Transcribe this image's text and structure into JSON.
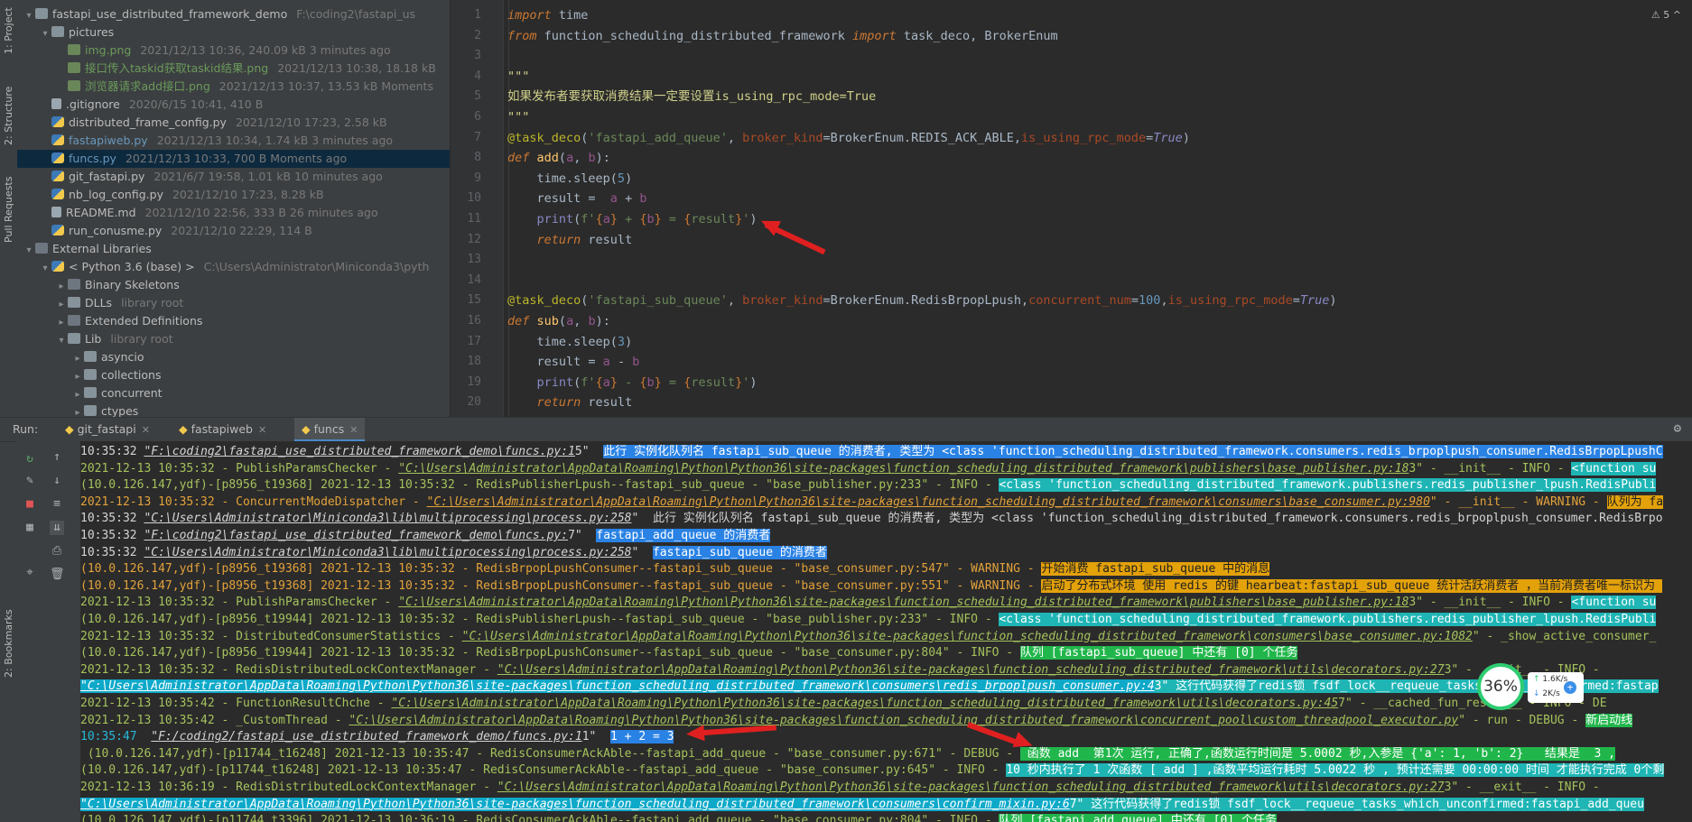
{
  "toolstrip": {
    "tabs": [
      "1: Project",
      "2: Structure",
      "Pull Requests",
      "2: Bookmarks"
    ]
  },
  "project": {
    "rows": [
      {
        "indent": 0,
        "arrow": "▾",
        "icon": "folder",
        "name": "fastapi_use_distributed_framework_demo",
        "meta": "F:\\coding2\\fastapi_us",
        "cls": ""
      },
      {
        "indent": 1,
        "arrow": "▾",
        "icon": "folder",
        "name": "pictures",
        "meta": "",
        "cls": ""
      },
      {
        "indent": 2,
        "arrow": "",
        "icon": "png",
        "name": "img.png",
        "meta": "2021/12/13 10:36, 240.09 kB 3 minutes ago",
        "cls": "name-green"
      },
      {
        "indent": 2,
        "arrow": "",
        "icon": "png",
        "name": "接口传入taskid获取taskid结果.png",
        "meta": "2021/12/13 10:38, 18.18 kB",
        "cls": "name-green"
      },
      {
        "indent": 2,
        "arrow": "",
        "icon": "png",
        "name": "浏览器请求add接口.png",
        "meta": "2021/12/13 10:37, 13.53 kB Moments",
        "cls": "name-green"
      },
      {
        "indent": 1,
        "arrow": "",
        "icon": "file",
        "name": ".gitignore",
        "meta": "2020/6/15 10:41, 410 B",
        "cls": ""
      },
      {
        "indent": 1,
        "arrow": "",
        "icon": "py",
        "name": "distributed_frame_config.py",
        "meta": "2021/12/10 17:23, 2.58 kB",
        "cls": ""
      },
      {
        "indent": 1,
        "arrow": "",
        "icon": "py",
        "name": "fastapiweb.py",
        "meta": "2021/12/13 10:34, 1.74 kB 3 minutes ago",
        "cls": "name-blue"
      },
      {
        "indent": 1,
        "arrow": "",
        "icon": "py",
        "name": "funcs.py",
        "meta": "2021/12/13 10:33, 700 B Moments ago",
        "cls": "name-blue",
        "selected": true
      },
      {
        "indent": 1,
        "arrow": "",
        "icon": "py",
        "name": "git_fastapi.py",
        "meta": "2021/6/7 19:58, 1.01 kB 10 minutes ago",
        "cls": ""
      },
      {
        "indent": 1,
        "arrow": "",
        "icon": "py",
        "name": "nb_log_config.py",
        "meta": "2021/12/10 17:23, 8.28 kB",
        "cls": ""
      },
      {
        "indent": 1,
        "arrow": "",
        "icon": "file",
        "name": "README.md",
        "meta": "2021/12/10 22:56, 333 B 26 minutes ago",
        "cls": ""
      },
      {
        "indent": 1,
        "arrow": "",
        "icon": "py",
        "name": "run_conusme.py",
        "meta": "2021/12/10 22:29, 114 B",
        "cls": ""
      },
      {
        "indent": 0,
        "arrow": "▾",
        "icon": "lib",
        "name": "External Libraries",
        "meta": "",
        "cls": ""
      },
      {
        "indent": 1,
        "arrow": "▾",
        "icon": "py",
        "name": "< Python 3.6 (base) >",
        "meta": "C:\\Users\\Administrator\\Miniconda3\\pyth",
        "cls": ""
      },
      {
        "indent": 2,
        "arrow": "▸",
        "icon": "lib",
        "name": "Binary Skeletons",
        "meta": "",
        "cls": ""
      },
      {
        "indent": 2,
        "arrow": "▸",
        "icon": "folder",
        "name": "DLLs",
        "meta": "library root",
        "cls": ""
      },
      {
        "indent": 2,
        "arrow": "▸",
        "icon": "lib",
        "name": "Extended Definitions",
        "meta": "",
        "cls": ""
      },
      {
        "indent": 2,
        "arrow": "▾",
        "icon": "folder",
        "name": "Lib",
        "meta": "library root",
        "cls": ""
      },
      {
        "indent": 3,
        "arrow": "▸",
        "icon": "folder",
        "name": "asyncio",
        "meta": "",
        "cls": ""
      },
      {
        "indent": 3,
        "arrow": "▸",
        "icon": "folder",
        "name": "collections",
        "meta": "",
        "cls": ""
      },
      {
        "indent": 3,
        "arrow": "▸",
        "icon": "folder",
        "name": "concurrent",
        "meta": "",
        "cls": ""
      },
      {
        "indent": 3,
        "arrow": "▸",
        "icon": "folder",
        "name": "ctypes",
        "meta": "",
        "cls": ""
      }
    ]
  },
  "editor": {
    "warning_badge": "⚠ 5  ^",
    "lines": [
      {
        "n": "1",
        "html": "<span class='kw'>import</span> time"
      },
      {
        "n": "2",
        "html": "<span class='kw'>from</span> function_scheduling_distributed_framework <span class='kw'>import</span> task_deco, BrokerEnum"
      },
      {
        "n": "3",
        "html": ""
      },
      {
        "n": "4",
        "html": "<span class='doc'>\"\"\"</span>"
      },
      {
        "n": "5",
        "html": "<span class='doc'>如果发布者要获取消费结果一定要设置is_using_rpc_mode=True</span>"
      },
      {
        "n": "6",
        "html": "<span class='doc'>\"\"\"</span>"
      },
      {
        "n": "7",
        "html": "<span class='ann'>@task_deco</span>(<span class='str'>'fastapi_add_queue'</span>, <span class='kwarg'>broker_kind</span>=BrokerEnum.REDIS_ACK_ABLE,<span class='kwarg'>is_using_rpc_mode</span>=<span class='trueval'>True</span>)"
      },
      {
        "n": "8",
        "html": "<span class='kw'>def</span> <span class='fn'>add</span>(<span class='prm'>a</span>, <span class='prm'>b</span>):"
      },
      {
        "n": "9",
        "html": "    time.sleep(<span class='num'>5</span>)"
      },
      {
        "n": "10",
        "html": "    result =  <span class='prm'>a</span> + <span class='prm'>b</span>"
      },
      {
        "n": "11",
        "html": "    <span class='fn' style='color:#8888c6'>print</span>(<span class='fstr'>f'<span class='brace'>{</span><span class='prm'>a</span><span class='brace'>}</span> + <span class='brace'>{</span><span class='prm'>b</span><span class='brace'>}</span> = <span class='brace'>{</span>result<span class='brace'>}</span>'</span>)"
      },
      {
        "n": "12",
        "html": "    <span class='kw'>return</span> result"
      },
      {
        "n": "13",
        "html": ""
      },
      {
        "n": "14",
        "html": ""
      },
      {
        "n": "15",
        "html": "<span class='ann'>@task_deco</span>(<span class='str'>'fastapi_sub_queue'</span>, <span class='kwarg'>broker_kind</span>=BrokerEnum.RedisBrpopLpush,<span class='kwarg'>concurrent_num</span>=<span class='num'>100</span>,<span class='kwarg'>is_using_rpc_mode</span>=<span class='trueval'>True</span>)"
      },
      {
        "n": "16",
        "html": "<span class='kw'>def</span> <span class='fn'>sub</span>(<span class='prm'>a</span>, <span class='prm'>b</span>):"
      },
      {
        "n": "17",
        "html": "    time.sleep(<span class='num'>3</span>)"
      },
      {
        "n": "18",
        "html": "    result = <span class='prm'>a</span> - <span class='prm'>b</span>"
      },
      {
        "n": "19",
        "html": "    <span class='fn' style='color:#8888c6'>print</span>(<span class='fstr'>f'<span class='brace'>{</span><span class='prm'>a</span><span class='brace'>}</span> - <span class='brace'>{</span><span class='prm'>b</span><span class='brace'>}</span> = <span class='brace'>{</span>result<span class='brace'>}</span>'</span>)"
      },
      {
        "n": "20",
        "html": "    <span class='kw'>return</span> result"
      }
    ]
  },
  "run": {
    "label": "Run:",
    "tabs": [
      {
        "name": "git_fastapi",
        "active": false
      },
      {
        "name": "fastapiweb",
        "active": false
      },
      {
        "name": "funcs",
        "active": true
      }
    ],
    "tool_icons": [
      "rerun-icon",
      "up-icon",
      "wrench-icon",
      "down-icon",
      "stop-icon",
      "soft-wrap-icon",
      "layout-icon",
      "scroll-end-icon",
      "print-icon",
      "pin-icon",
      "trash-icon"
    ]
  },
  "console": {
    "lines": [
      "<span class='c-white'>10:35:32 </span><span class='c-link'>\"F:\\coding2\\fastapi_use_distributed_framework_demo\\funcs.py:1</span><span class='c-white'>5\"  </span><span class='hl-blue'>此行 实例化队列名 fastapi_sub_queue 的消费者, 类型为 &lt;class 'function_scheduling_distributed_framework.consumers.redis_brpoplpush_consumer.RedisBrpopLpushC</span>",
      "<span class='c-green'>2021-12-13 10:35:32 - PublishParamsChecker - </span><span class='c-link' style='color:#a5c25c'>\"C:\\Users\\Administrator\\AppData\\Roaming\\Python\\Python36\\site-packages\\function_scheduling_distributed_framework\\publishers\\base_publisher.py:18</span><span class='c-green'>3\" - __init__ - INFO - </span><span class='hl-teal'>&lt;function su</span>",
      "<span class='c-green'>(10.0.126.147,ydf)-[p8956_t19368] 2021-12-13 10:35:32 - RedisPublisherLpush--fastapi_sub_queue - \"base_publisher.py:233\" - INFO - </span><span class='hl-teal'>&lt;class 'function_scheduling_distributed_framework.publishers.redis_publisher_lpush.RedisPubli</span>",
      "<span class='c-orange'>2021-12-13 10:35:32 - ConcurrentModeDispatcher - </span><span class='c-link' style='color:#e3a23b'>\"C:\\Users\\Administrator\\AppData\\Roaming\\Python\\Python36\\site-packages\\function_scheduling_distributed_framework\\consumers\\base_consumer.py:980</span><span class='c-orange'>\" - __init__ - WARNING - </span><span class='hl-orange'>队列为 fa</span>",
      "<span class='c-white'>10:35:32 </span><span class='c-link'>\"C:\\Users\\Administrator\\Miniconda3\\lib\\multiprocessing\\process.py:258</span><span class='c-white'>\"  此行 实例化队列名 fastapi_sub_queue 的消费者, 类型为 &lt;class 'function_scheduling_distributed_framework.consumers.redis_brpoplpush_consumer.RedisBrpo</span>",
      "<span class='c-white'>10:35:32 </span><span class='c-link'>\"F:\\coding2\\fastapi_use_distributed_framework_demo\\funcs.py:</span><span class='c-white'>7\"  </span><span class='hl-blue'>fastapi_add_queue 的消费者</span>",
      "<span class='c-white'>10:35:32 </span><span class='c-link'>\"C:\\Users\\Administrator\\Miniconda3\\lib\\multiprocessing\\process.py:258</span><span class='c-white'>\"  </span><span class='hl-blue'>fastapi_sub_queue 的消费者</span>",
      "<span class='c-orange'>(10.0.126.147,ydf)-[p8956_t19368] 2021-12-13 10:35:32 - RedisBrpopLpushConsumer--fastapi_sub_queue - \"base_consumer.py:547\" - WARNING - </span><span class='hl-orange'>开始消费 fastapi_sub_queue 中的消息</span>",
      "<span class='c-orange'>(10.0.126.147,ydf)-[p8956_t19368] 2021-12-13 10:35:32 - RedisBrpopLpushConsumer--fastapi_sub_queue - \"base_consumer.py:551\" - WARNING - </span><span class='hl-orange'>启动了分布式环境 使用 redis 的键 hearbeat:fastapi_sub_queue 统计活跃消费者 ，当前消费者唯一标识为 </span>",
      "<span class='c-green'>2021-12-13 10:35:32 - PublishParamsChecker - </span><span class='c-link' style='color:#a5c25c'>\"C:\\Users\\Administrator\\AppData\\Roaming\\Python\\Python36\\site-packages\\function_scheduling_distributed_framework\\publishers\\base_publisher.py:18</span><span class='c-green'>3\" - __init__ - INFO - </span><span class='hl-teal'>&lt;function su</span>",
      "<span class='c-green'>(10.0.126.147,ydf)-[p8956_t19944] 2021-12-13 10:35:32 - RedisPublisherLpush--fastapi_sub_queue - \"base_publisher.py:233\" - INFO - </span><span class='hl-teal'>&lt;class 'function_scheduling_distributed_framework.publishers.redis_publisher_lpush.RedisPubli</span>",
      "<span class='c-green'>2021-12-13 10:35:32 - DistributedConsumerStatistics - </span><span class='c-link' style='color:#a5c25c'>\"C:\\Users\\Administrator\\AppData\\Roaming\\Python\\Python36\\site-packages\\function_scheduling_distributed_framework\\consumers\\base_consumer.py:1082</span><span class='c-green'>\" - _show_active_consumer_</span>",
      "<span class='c-green'>(10.0.126.147,ydf)-[p8956_t19944] 2021-12-13 10:35:32 - RedisBrpopLpushConsumer--fastapi_sub_queue - \"base_consumer.py:804\" - INFO - </span><span class='hl-green'>队列 [fastapi_sub_queue] 中还有 [0] 个任务</span>",
      "<span class='c-green'>2021-12-13 10:35:32 - RedisDistributedLockContextManager - </span><span class='c-link' style='color:#a5c25c'>\"C:\\Users\\Administrator\\AppData\\Roaming\\Python\\Python36\\site-packages\\function_scheduling_distributed_framework\\utils\\decorators.py:27</span><span class='c-green'>3\" - __exit__ - INFO - </span>",
      "<span class='hl-link'>\"C:\\Users\\Administrator\\AppData\\Roaming\\Python\\Python36\\site-packages\\function_scheduling_distributed_framework\\consumers\\redis_brpoplpush_consumer.py:4</span><span class='hl-teal'>3\" 这行代码获得了redis锁 fsdf_lock__requeue_tasks_which_unconfirmed:fastap</span>",
      "<span class='c-green'>2021-12-13 10:35:42 - FunctionResultChche - </span><span class='c-link' style='color:#a5c25c'>\"C:\\Users\\Administrator\\AppData\\Roaming\\Python\\Python36\\site-packages\\function_scheduling_distributed_framework\\utils\\decorators.py:45</span><span class='c-green'>7\" - __cached_fun_result__ - INFO - DE</span>",
      "<span class='c-green'>2021-12-13 10:35:42 - _CustomThread - </span><span class='c-link' style='color:#a5c25c'>\"C:\\Users\\Administrator\\AppData\\Roaming\\Python\\Python36\\site-packages\\function_scheduling_distributed_framework\\concurrent_pool\\custom_threadpool_executor.py</span><span class='c-green'>\" - run - DEBUG - </span><span class='hl-green'>新启动线</span>",
      "<span class='c-cyan'>10:35:47  </span><span class='c-link'>\"F:/coding2/fastapi_use_distributed_framework_demo/funcs.py:1</span><span class='c-white'>1\"  </span><span class='hl-blue'>1 + 2 = 3</span>",
      "<span class='c-green'> (10.0.126.147,ydf)-[p11744_t16248] 2021-12-13 10:35:47 - RedisConsumerAckAble--fastapi_add_queue - \"base_consumer.py:671\" - DEBUG - </span><span class='hl-green'> 函数 add  第1次 运行, 正确了,函数运行时间是 5.0002 秒,入参是 {'a': 1, 'b': 2}   结果是  3 ,</span>",
      "<span class='c-green'>(10.0.126.147,ydf)-[p11744_t16248] 2021-12-13 10:35:47 - RedisConsumerAckAble--fastapi_add_queue - \"base_consumer.py:645\" - INFO - </span><span class='hl-teal'>10 秒内执行了 1 次函数 [ add ] ,函数平均运行耗时 5.0022 秒 , 预计还需要 00:00:00 时间 才能执行完成 0个剩</span>",
      "<span class='c-green'>2021-12-13 10:36:19 - RedisDistributedLockContextManager - </span><span class='c-link' style='color:#a5c25c'>\"C:\\Users\\Administrator\\AppData\\Roaming\\Python\\Python36\\site-packages\\function_scheduling_distributed_framework\\utils\\decorators.py:27</span><span class='c-green'>3\" - __exit__ - INFO - </span>",
      "<span class='hl-link'>\"C:\\Users\\Administrator\\AppData\\Roaming\\Python\\Python36\\site-packages\\function_scheduling_distributed_framework\\consumers\\confirm_mixin.py:6</span><span class='hl-teal'>7\" 这行代码获得了redis锁 fsdf_lock__requeue_tasks_which_unconfirmed:fastapi_add_queu</span>",
      "<span class='c-green'>(10.0.126.147,ydf)-[p11744_t3396] 2021-12-13 10:36:19 - RedisConsumerAckAble--fastapi_add_queue - \"base_consumer.py:804\" - INFO - </span><span class='hl-green'>队列 [fastapi_add_queue] 中还有 [0] 个任务</span>"
    ]
  },
  "speed_widget": {
    "percent": "36%",
    "upload": "1.6K/s",
    "download": "2K/s",
    "plus": "+"
  },
  "colors": {
    "accent": "#4a88c7",
    "arrow_red": "#e02020"
  }
}
